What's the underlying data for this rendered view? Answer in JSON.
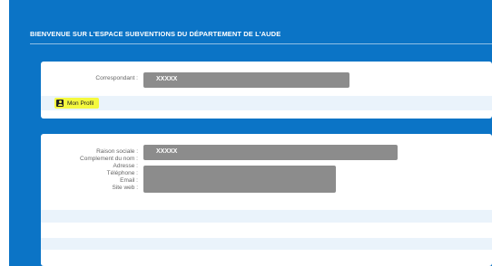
{
  "header": {
    "title": "BIENVENUE SUR L'ESPACE SUBVENTIONS DU DÉPARTEMENT DE L'AUDE"
  },
  "correspondant": {
    "label": "Correspondant :",
    "value": "XXXXX"
  },
  "profile_button": {
    "label": "Mon Profil",
    "icon": "user-card-icon"
  },
  "organisation": {
    "raison_sociale_label": "Raison sociale :",
    "raison_sociale_value": "XXXXX",
    "complement_label": "Complement du nom :",
    "adresse_label": "Adresse :",
    "telephone_label": "Téléphone :",
    "email_label": "Email :",
    "site_web_label": "Site web :"
  }
}
